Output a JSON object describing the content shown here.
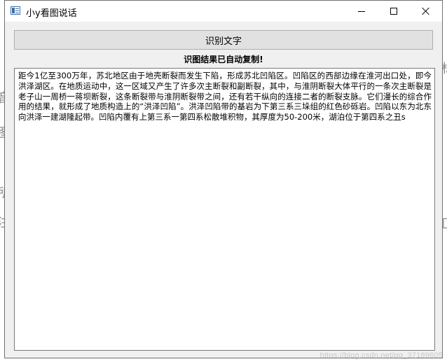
{
  "window": {
    "title": "小y看图说话",
    "controls": {
      "minimize": "minimize",
      "maximize": "maximize",
      "close": "close"
    }
  },
  "toolbar": {
    "ocr_button_label": "识别文字"
  },
  "status": {
    "message": "识图结果已自动复制!"
  },
  "result": {
    "text": "距今1亿至300万年，苏北地区由于地壳断裂而发生下陷，形成苏北凹陷区。凹陷区的西部边缘在淮河出口处，即今洪泽湖区。在地质运动中，这一区域又产生了许多次主断裂和副断裂，其中，与淮阴断裂大体平行的一条次主断裂是老子山一周桥一蒋坝断裂，这条断裂带与淮阴断裂带之间，还有若干纵向的连接二者的断裂支脉。它们漫长的综合作用的结果，就形成了地质构造上的“洪泽凹陷”。洪泽凹陷带的基岩为下第三系三垛组的红色砂砾岩。凹陷以东为北东向洪泽一建湖隆起带。凹陷内覆有上第三系一第四系松散堆积物，其厚度为50-200米，湖泊位于第四系之丑s"
  },
  "background": {
    "watermark": "https://blog.csdn.net/qq_37189605"
  }
}
